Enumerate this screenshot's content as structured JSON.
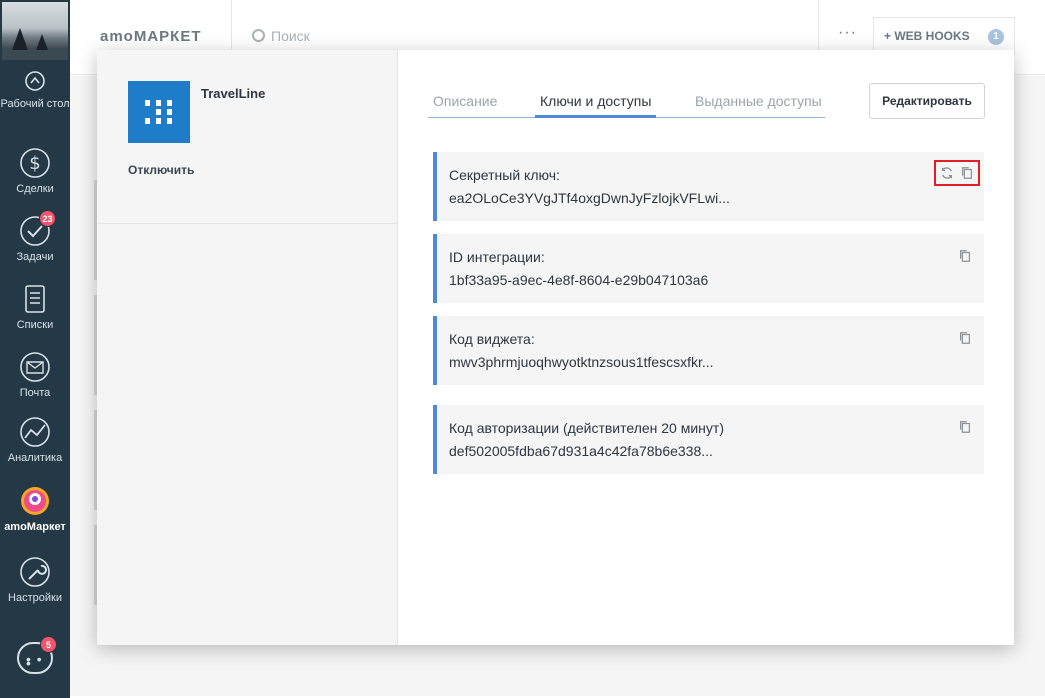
{
  "sidebar": {
    "items": [
      {
        "key": "dashboard",
        "label": "Рабочий стол"
      },
      {
        "key": "deals",
        "label": "Сделки"
      },
      {
        "key": "tasks",
        "label": "Задачи",
        "badge": "23"
      },
      {
        "key": "lists",
        "label": "Списки"
      },
      {
        "key": "mail",
        "label": "Почта"
      },
      {
        "key": "analytics",
        "label": "Аналитика"
      },
      {
        "key": "amomarket",
        "label": "amoМаркет",
        "active": true
      },
      {
        "key": "settings",
        "label": "Настройки"
      }
    ],
    "chat_badge": "5"
  },
  "topbar": {
    "brand": "amoМАРКЕТ",
    "search_placeholder": "Поиск",
    "more": "···",
    "webhooks_label": "+ WEB HOOKS",
    "webhooks_badge": "1"
  },
  "modal": {
    "app_name": "TravelLine",
    "disable_label": "Отключить",
    "tabs": [
      {
        "label": "Описание"
      },
      {
        "label": "Ключи и доступы",
        "active": true
      },
      {
        "label": "Выданные доступы"
      }
    ],
    "edit_label": "Редактировать",
    "keys": [
      {
        "label": "Секретный ключ:",
        "value": "ea2OLoCe3YVgJTf4oxgDwnJyFzlojkVFLwi...",
        "refresh": true
      },
      {
        "label": "ID интеграции:",
        "value": "1bf33a95-a9ec-4e8f-8604-e29b047103a6"
      },
      {
        "label": "Код виджета:",
        "value": "mwv3phrmjuoqhwyotktnzsous1tfescsxfkr..."
      },
      {
        "label": "Код авторизации (действителен 20 минут)",
        "value": "def502005fdba67d931a4c42fa78b6e338..."
      }
    ]
  },
  "colors": {
    "sidebar_bg": "#243845",
    "accent": "#4c8bd4",
    "logo": "#1f7cc9",
    "highlight": "#e41e26",
    "badge": "#f2556b"
  }
}
